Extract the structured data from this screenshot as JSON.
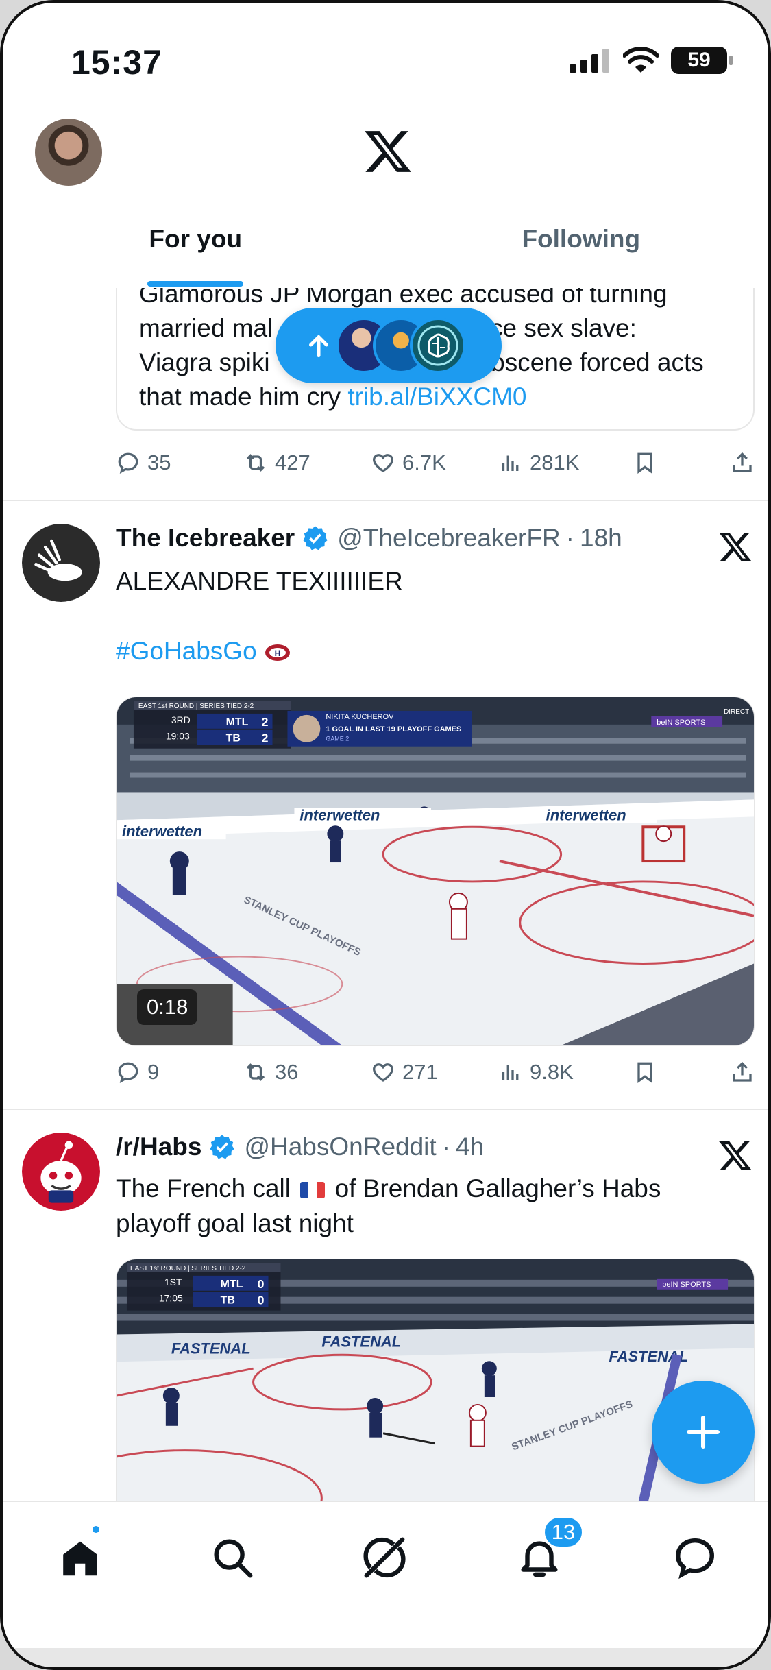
{
  "status_bar": {
    "time": "15:37",
    "battery": "59"
  },
  "header": {
    "tabs": [
      {
        "label": "For you",
        "active": true
      },
      {
        "label": "Following",
        "active": false
      }
    ]
  },
  "quote_post": {
    "lines": [
      "Glamorous JP Morgan exec accused of turning",
      "married mal",
      "office sex slave:",
      "Viagra spiki",
      "obscene forced acts",
      "that made him cry"
    ],
    "link": "trib.al/BiXXCM0",
    "stats": {
      "replies": "35",
      "reposts": "427",
      "likes": "6.7K",
      "views": "281K"
    }
  },
  "new_posts_pill": {
    "arrow": "up-arrow-icon"
  },
  "posts": [
    {
      "name": "The Icebreaker",
      "handle": "@TheIcebreakerFR",
      "sep": "·",
      "time": "18h",
      "text": "ALEXANDRE TEXIIIIIIER",
      "hashtag": "#GoHabsGo",
      "media": {
        "duration": "0:18",
        "scorebug": {
          "round": "EAST 1st ROUND | SERIES TIED 2-2",
          "period": "3RD",
          "clock": "19:03",
          "home": "MTL",
          "home_score": "2",
          "away": "TB",
          "away_score": "2",
          "player": "NIKITA KUCHEROV",
          "stat": "1 GOAL IN LAST 19 PLAYOFF GAMES",
          "game": "GAME 2",
          "broadcaster": "beIN SPORTS",
          "live": "DIRECT"
        },
        "ads": [
          "interwetten",
          "interwetten",
          "interwetten"
        ],
        "ice_logo": "STANLEY CUP PLAYOFFS"
      },
      "stats": {
        "replies": "9",
        "reposts": "36",
        "likes": "271",
        "views": "9.8K"
      }
    },
    {
      "name": "/r/Habs",
      "handle": "@HabsOnReddit",
      "sep": "·",
      "time": "4h",
      "text_a": "The French call",
      "flag": "🇫🇷",
      "text_b": "of Brendan Gallagher’s Habs",
      "text_c": "playoff goal last night",
      "media": {
        "scorebug": {
          "round": "EAST 1st ROUND | SERIES TIED 2-2",
          "period": "1ST",
          "clock": "17:05",
          "home": "MTL",
          "home_score": "0",
          "away": "TB",
          "away_score": "0",
          "broadcaster": "beIN SPORTS"
        },
        "ads": [
          "FASTENAL",
          "FASTENAL",
          "FASTENAL"
        ],
        "ice_logo": "STANLEY CUP PLAYOFFS"
      }
    }
  ],
  "bottom_nav": {
    "notifications_badge": "13"
  },
  "colors": {
    "accent": "#1d9bf0",
    "text": "#0f1419",
    "muted": "#536471"
  }
}
